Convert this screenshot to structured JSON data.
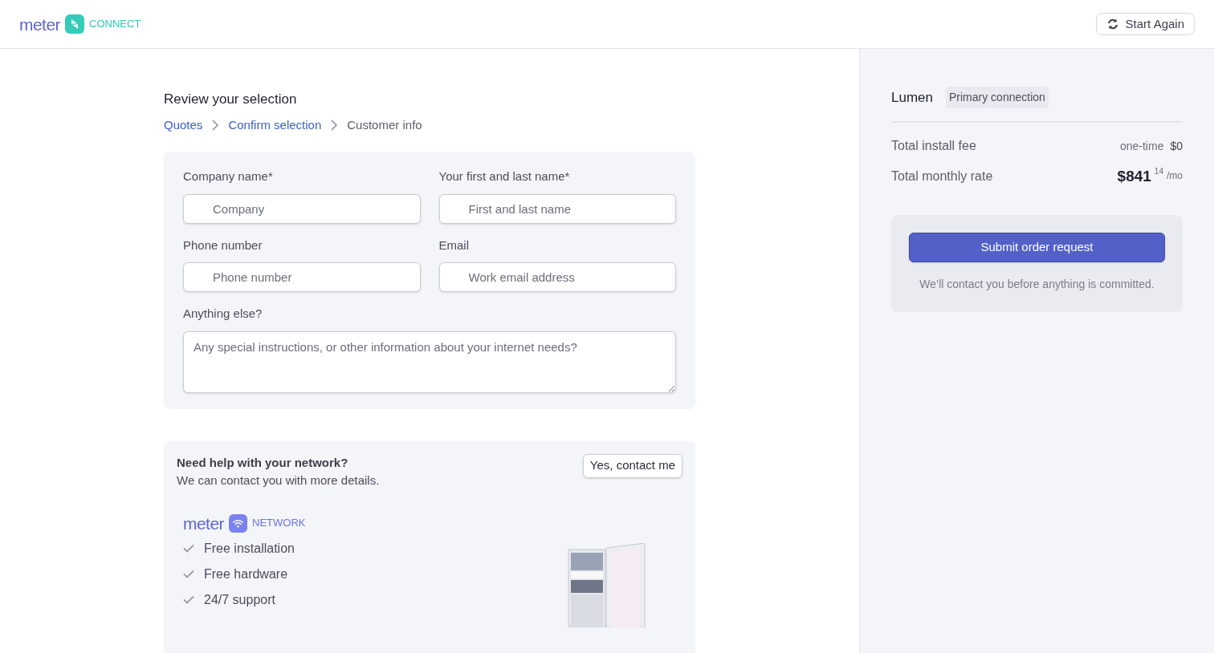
{
  "header": {
    "logo_word": "meter",
    "logo_product": "CONNECT",
    "start_again": "Start Again"
  },
  "heading": "Review your selection",
  "breadcrumbs": [
    {
      "label": "Quotes",
      "current": false
    },
    {
      "label": "Confirm selection",
      "current": false
    },
    {
      "label": "Customer info",
      "current": true
    }
  ],
  "form": {
    "fields": [
      {
        "label": "Company name*",
        "placeholder": "Company",
        "kind": "input"
      },
      {
        "label": "Your first and last name*",
        "placeholder": "First and last name",
        "kind": "input"
      },
      {
        "label": "Phone number",
        "placeholder": "Phone number",
        "kind": "input"
      },
      {
        "label": "Email",
        "placeholder": "Work email address",
        "kind": "input"
      },
      {
        "label": "Anything else?",
        "placeholder": "Any special instructions, or other information about your internet needs?",
        "kind": "textarea"
      }
    ]
  },
  "network_help": {
    "title": "Need help with your network?",
    "subtitle": "We can contact you with more details.",
    "button": "Yes, contact me",
    "logo_word": "meter",
    "logo_product": "NETWORK",
    "features": [
      "Free installation",
      "Free hardware",
      "24/7 support"
    ]
  },
  "summary": {
    "provider": "Lumen",
    "tag": "Primary connection",
    "install_fee": {
      "label": "Total install fee",
      "note": "one-time",
      "value": "$0"
    },
    "monthly_rate": {
      "label": "Total monthly rate",
      "dollars": "$841",
      "cents": "14",
      "unit": "/mo"
    },
    "submit": "Submit order request",
    "note": "We’ll contact you before anything is committed."
  }
}
